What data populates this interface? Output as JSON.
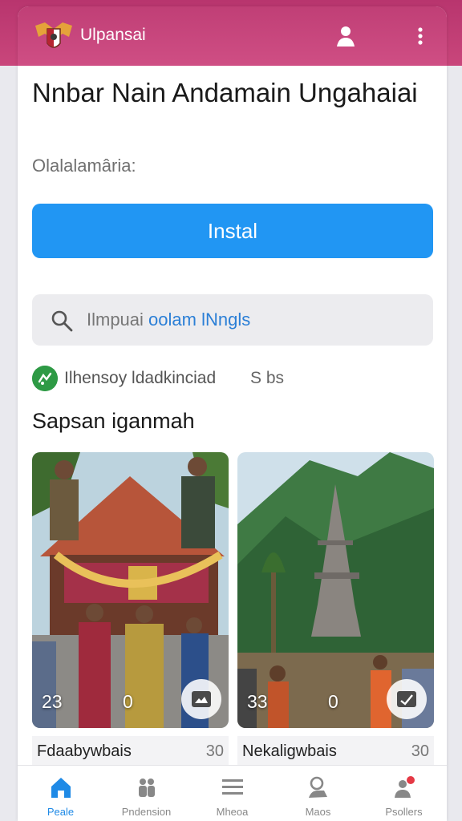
{
  "header": {
    "app_name": "Ulpansai",
    "logo_icon": "coat-of-arms-logo",
    "user_icon": "user-icon",
    "menu_icon": "more-vert-icon",
    "color": "#c64277"
  },
  "main": {
    "title": "Nnbar Nain Andamain Ungahaiai",
    "subtitle": "Olalalamâria:",
    "install_label": "Instal",
    "install_color": "#2196f3"
  },
  "search": {
    "prefix": "Ilmpuai",
    "highlight": "oolam lNngls"
  },
  "info": {
    "text": "Ilhensoy ldadkinciad",
    "count": "S bs"
  },
  "section": {
    "title": "Sapsan iganmah"
  },
  "cards": [
    {
      "count_a": "23",
      "count_b": "0",
      "caption": "Fdaabywbais",
      "caption_num": "30"
    },
    {
      "count_a": "33",
      "count_b": "0",
      "caption": "Nekaligwbais",
      "caption_num": "30"
    }
  ],
  "nav": [
    {
      "label": "Peale",
      "icon": "home-icon",
      "active": true
    },
    {
      "label": "Pndension",
      "icon": "people-icon",
      "active": false
    },
    {
      "label": "Mheoa",
      "icon": "menu-lines-icon",
      "active": false
    },
    {
      "label": "Maos",
      "icon": "profile-edit-icon",
      "active": false
    },
    {
      "label": "Psollers",
      "icon": "person-badge-icon",
      "active": false
    }
  ]
}
